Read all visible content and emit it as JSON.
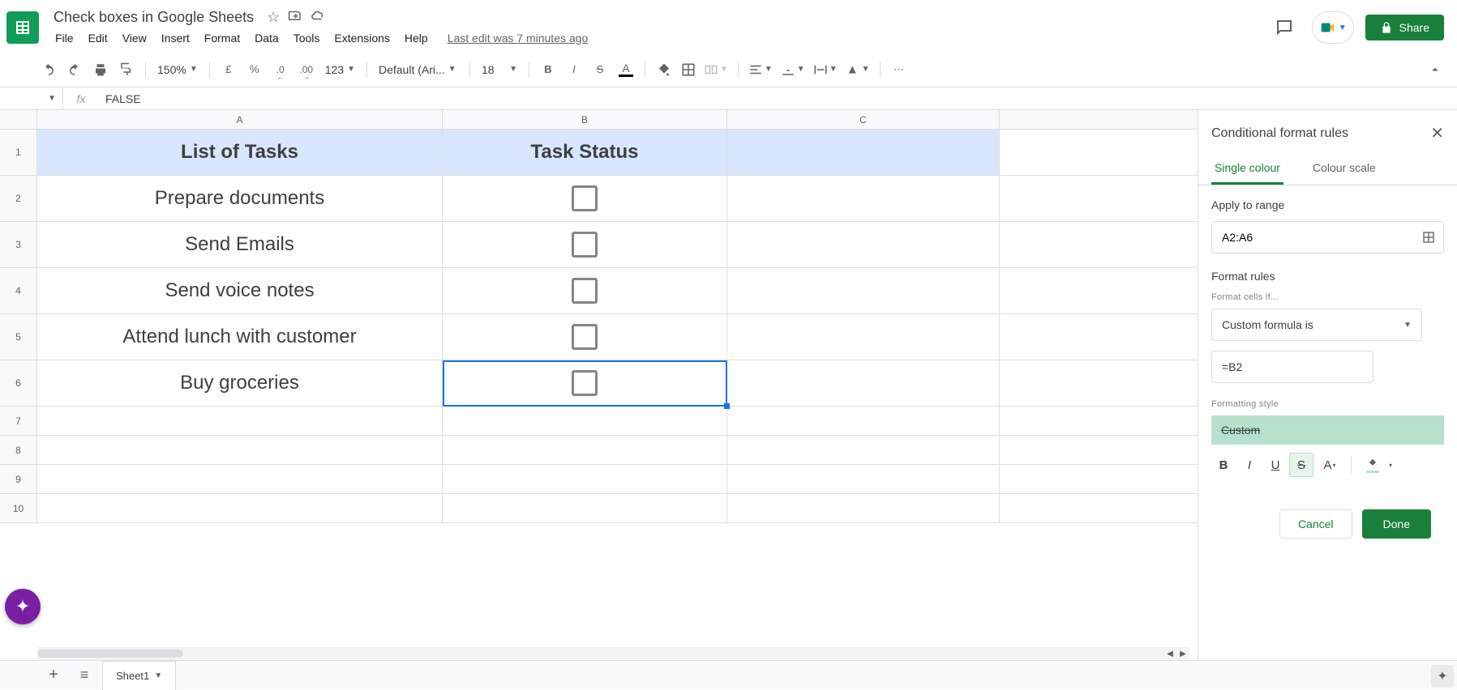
{
  "doc_title": "Check boxes in Google Sheets",
  "last_edit": "Last edit was 7 minutes ago",
  "menus": [
    "File",
    "Edit",
    "View",
    "Insert",
    "Format",
    "Data",
    "Tools",
    "Extensions",
    "Help"
  ],
  "share_label": "Share",
  "toolbar": {
    "zoom": "150%",
    "font": "Default (Ari...",
    "font_size": "18",
    "number_format": "123"
  },
  "name_box": "",
  "formula_value": "FALSE",
  "columns": [
    "A",
    "B",
    "C"
  ],
  "row_numbers": [
    "1",
    "2",
    "3",
    "4",
    "5",
    "6",
    "7",
    "8",
    "9",
    "10"
  ],
  "header_row": {
    "A": "List of Tasks",
    "B": "Task Status"
  },
  "tasks": [
    "Prepare documents",
    "Send Emails",
    "Send voice notes",
    "Attend lunch with customer",
    "Buy groceries"
  ],
  "active_cell": "B6",
  "sidebar": {
    "title": "Conditional format rules",
    "tab_single": "Single colour",
    "tab_scale": "Colour scale",
    "apply_label": "Apply to range",
    "range": "A2:A6",
    "rules_label": "Format rules",
    "cells_if_label": "Format cells if...",
    "condition": "Custom formula is",
    "formula": "=B2",
    "style_label": "Formatting style",
    "style_preview": "Custom",
    "cancel": "Cancel",
    "done": "Done"
  },
  "sheet_tab": "Sheet1"
}
